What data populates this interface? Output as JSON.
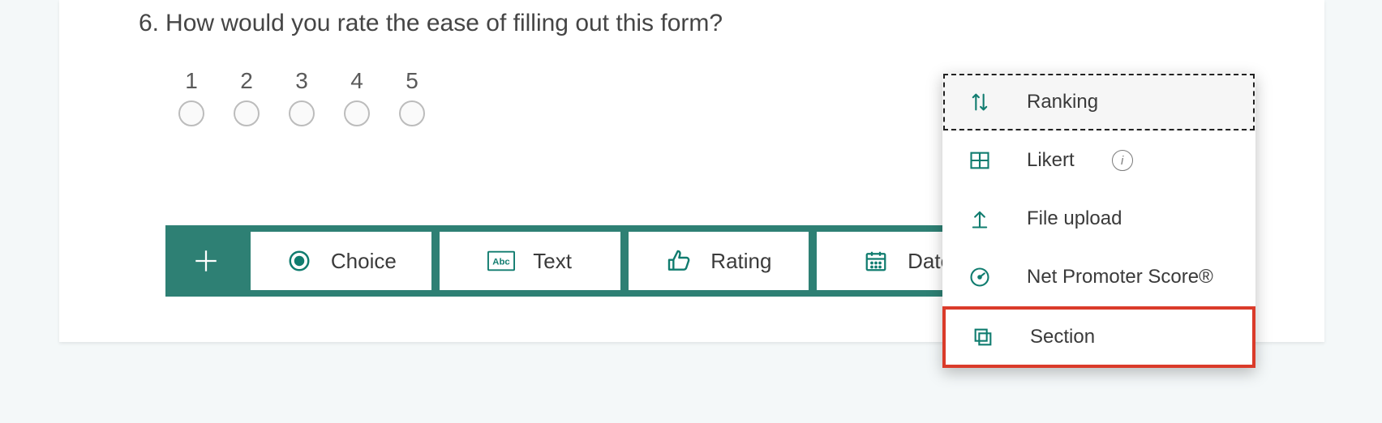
{
  "question": {
    "number": "6.",
    "text": "How would you rate the ease of filling out this form?",
    "scale": [
      "1",
      "2",
      "3",
      "4",
      "5"
    ]
  },
  "toolbar": {
    "choice": "Choice",
    "text": "Text",
    "rating": "Rating",
    "date": "Date"
  },
  "menu": {
    "ranking": "Ranking",
    "likert": "Likert",
    "file_upload": "File upload",
    "nps": "Net Promoter Score®",
    "section": "Section"
  },
  "colors": {
    "teal": "#107c6f"
  }
}
